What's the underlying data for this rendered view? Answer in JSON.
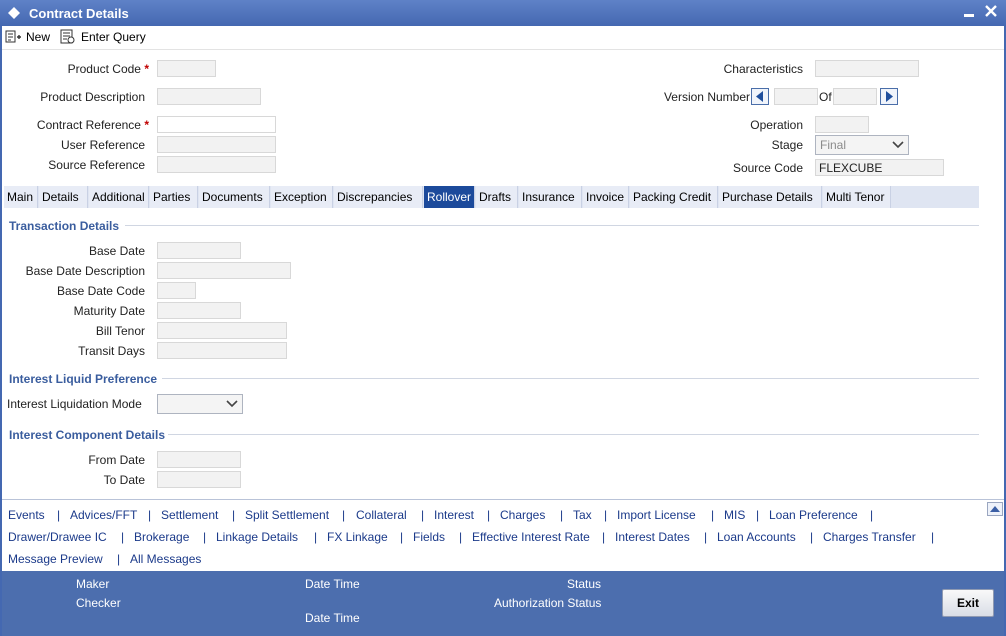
{
  "window": {
    "title": "Contract Details"
  },
  "toolbar": {
    "new_label": "New",
    "enter_query_label": "Enter Query"
  },
  "header": {
    "product_code_label": "Product Code",
    "product_description_label": "Product Description",
    "contract_reference_label": "Contract Reference",
    "user_reference_label": "User Reference",
    "source_reference_label": "Source Reference",
    "required_marker": "*",
    "characteristics_label": "Characteristics",
    "version_number_label": "Version Number",
    "of_label": "Of",
    "operation_label": "Operation",
    "stage_label": "Stage",
    "stage_value": "Final",
    "source_code_label": "Source Code",
    "source_code_value": "FLEXCUBE"
  },
  "tabs": [
    "Main",
    "Details",
    "Additional",
    "Parties",
    "Documents",
    "Exception",
    "Discrepancies",
    "Rollover",
    "Drafts",
    "Insurance",
    "Invoice",
    "Packing Credit",
    "Purchase Details",
    "Multi Tenor"
  ],
  "active_tab": "Rollover",
  "transaction": {
    "section_title": "Transaction Details",
    "base_date_label": "Base Date",
    "base_date_description_label": "Base Date Description",
    "base_date_code_label": "Base Date Code",
    "maturity_date_label": "Maturity Date",
    "bill_tenor_label": "Bill Tenor",
    "transit_days_label": "Transit Days"
  },
  "interest_pref": {
    "section_title": "Interest Liquid Preference",
    "liquidation_mode_label": "Interest Liquidation Mode"
  },
  "interest_component": {
    "section_title": "Interest Component Details",
    "from_date_label": "From Date",
    "to_date_label": "To Date"
  },
  "links": {
    "row1": [
      "Events",
      "Advices/FFT",
      "Settlement",
      "Split Settlement",
      "Collateral",
      "Interest",
      "Charges",
      "Tax",
      "Import License",
      "MIS",
      "Loan Preference"
    ],
    "row2": [
      "Drawer/Drawee IC",
      "Brokerage",
      "Linkage Details",
      "FX Linkage",
      "Fields",
      "Effective Interest Rate",
      "Interest Dates",
      "Loan Accounts",
      "Charges Transfer"
    ],
    "row3": [
      "Message Preview",
      "All Messages"
    ],
    "separator": "|"
  },
  "footer": {
    "maker_label": "Maker",
    "checker_label": "Checker",
    "date_time_label": "Date Time",
    "status_label": "Status",
    "authorization_status_label": "Authorization Status",
    "exit_label": "Exit"
  },
  "colors": {
    "title_bar": "#4468b1",
    "active_tab": "#1c4a9b",
    "footer": "#4c6eae",
    "section": "#3a5d9e",
    "link": "#1b3a8a",
    "required": "#c00000"
  }
}
